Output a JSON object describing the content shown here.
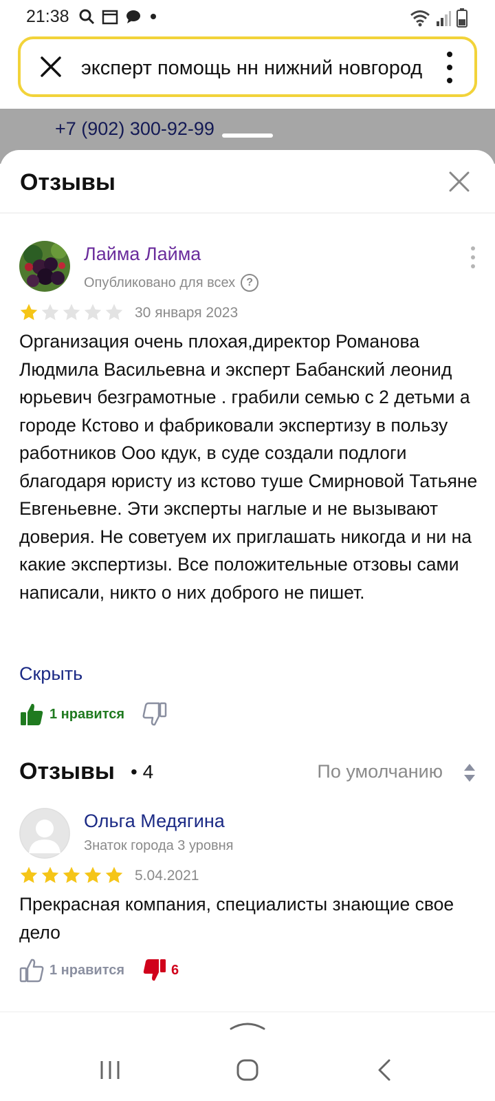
{
  "status_bar": {
    "time": "21:38"
  },
  "search": {
    "query": "эксперт помощь нн нижний новгород",
    "close_icon": "close-icon",
    "menu_icon": "more-vertical-icon"
  },
  "background": {
    "phone": "+7 (902) 300-92-99"
  },
  "sheet": {
    "title": "Отзывы"
  },
  "featured_review": {
    "author": "Лайма Лайма",
    "visibility": "Опубликовано для всех",
    "rating": 1,
    "max_rating": 5,
    "date": "30 января 2023",
    "text": "Организация очень плохая,директор Романова Людмила Васильевна и эксперт Бабанский леонид юрьевич безграмотные . грабили семью с 2 детьми а городе Кстово и фабриковали экспертизу в пользу работников Ооо кдук, в суде создали подлоги благодаря юристу из кстово туше Смирновой Татьяне Евгеньевне. Эти эксперты наглые и не вызывают доверия. Не советуем их приглашать никогда и ни на какие экспертизы. Все положительные отзовы сами написали, никто о них доброго не пишет.",
    "hide_label": "Скрыть",
    "likes_label": "1 нравится",
    "author_color": "#6a2c9c",
    "like_color": "#1f7a1f"
  },
  "reviews_list": {
    "title": "Отзывы",
    "count": "• 4",
    "sort_label": "По умолчанию"
  },
  "review_2": {
    "author": "Ольга Медягина",
    "level": "Знаток города 3 уровня",
    "rating": 5,
    "max_rating": 5,
    "date": "5.04.2021",
    "text": "Прекрасная компания, специалисты знающие свое дело",
    "likes_label": "1 нравится",
    "dislikes": "6",
    "author_color": "#1b2a85",
    "dislike_color": "#d0021b"
  },
  "colors": {
    "star_filled": "#f5c518",
    "star_empty": "#e3e3e3",
    "search_border": "#f2d33a",
    "link": "#1b2a85"
  }
}
